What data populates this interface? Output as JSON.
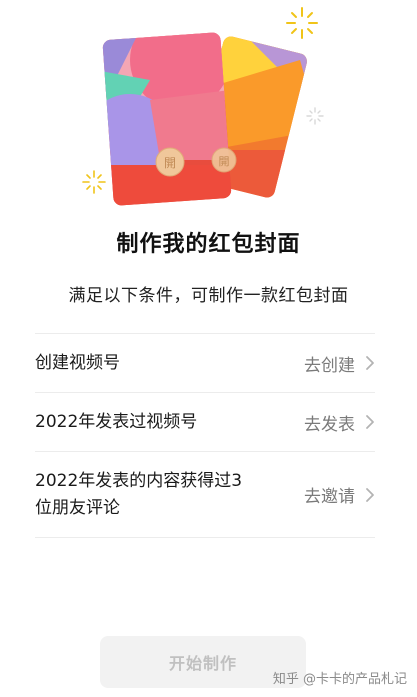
{
  "header": {
    "title": "制作我的红包封面",
    "subtitle": "满足以下条件，可制作一款红包封面"
  },
  "conditions": [
    {
      "label": "创建视频号",
      "action": "去创建"
    },
    {
      "label": "2022年发表过视频号",
      "action": "去发表"
    },
    {
      "label": "2022年发表的内容获得过3位朋友评论",
      "action": "去邀请"
    }
  ],
  "envelope_seals": [
    "開",
    "開"
  ],
  "footer": {
    "start_button": "开始制作",
    "watermark": "知乎 @卡卡的产品札记"
  },
  "colors": {
    "envelope_red": "#e84c3d",
    "disabled_button_bg": "#f2f2f2",
    "disabled_button_text": "#c0c0c0",
    "sparkle_gold": "#f0c419"
  }
}
